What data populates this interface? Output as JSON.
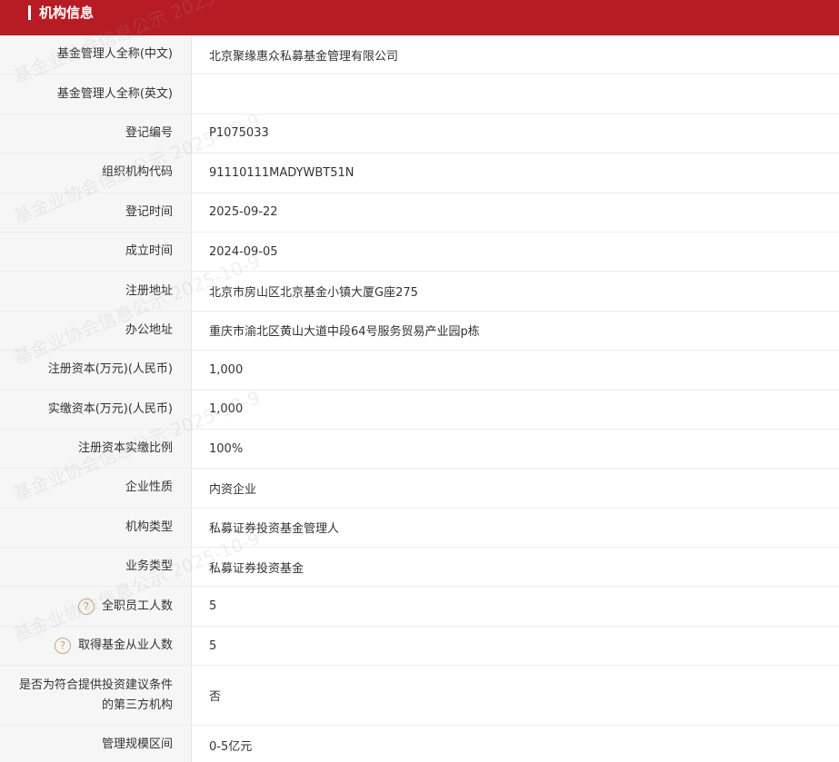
{
  "header": {
    "title": "机构信息"
  },
  "rows": [
    {
      "label": "基金管理人全称(中文)",
      "value": "北京聚缘惠众私募基金管理有限公司"
    },
    {
      "label": "基金管理人全称(英文)",
      "value": ""
    },
    {
      "label": "登记编号",
      "value": "P1075033"
    },
    {
      "label": "组织机构代码",
      "value": "91110111MADYWBT51N"
    },
    {
      "label": "登记时间",
      "value": "2025-09-22"
    },
    {
      "label": "成立时间",
      "value": "2024-09-05"
    },
    {
      "label": "注册地址",
      "value": "北京市房山区北京基金小镇大厦G座275"
    },
    {
      "label": "办公地址",
      "value": "重庆市渝北区黄山大道中段64号服务贸易产业园p栋"
    },
    {
      "label": "注册资本(万元)(人民币)",
      "value": "1,000"
    },
    {
      "label": "实缴资本(万元)(人民币)",
      "value": "1,000"
    },
    {
      "label": "注册资本实缴比例",
      "value": "100%"
    },
    {
      "label": "企业性质",
      "value": "内资企业"
    },
    {
      "label": "机构类型",
      "value": "私募证券投资基金管理人"
    },
    {
      "label": "业务类型",
      "value": "私募证券投资基金"
    },
    {
      "label": "全职员工人数",
      "value": "5",
      "help_icon": "question-circle-icon"
    },
    {
      "label": "取得基金从业人数",
      "value": "5",
      "help_icon": "question-circle-icon"
    },
    {
      "label": "是否为符合提供投资建议条件的第三方机构",
      "value": "否"
    },
    {
      "label": "管理规模区间",
      "value": "0-5亿元"
    }
  ],
  "watermark": "基金业协会信息公示 2025-10-9",
  "colors": {
    "header_bg": "#b71c24",
    "label_bg": "#f6f6f6",
    "help_icon": "#c8a882"
  }
}
